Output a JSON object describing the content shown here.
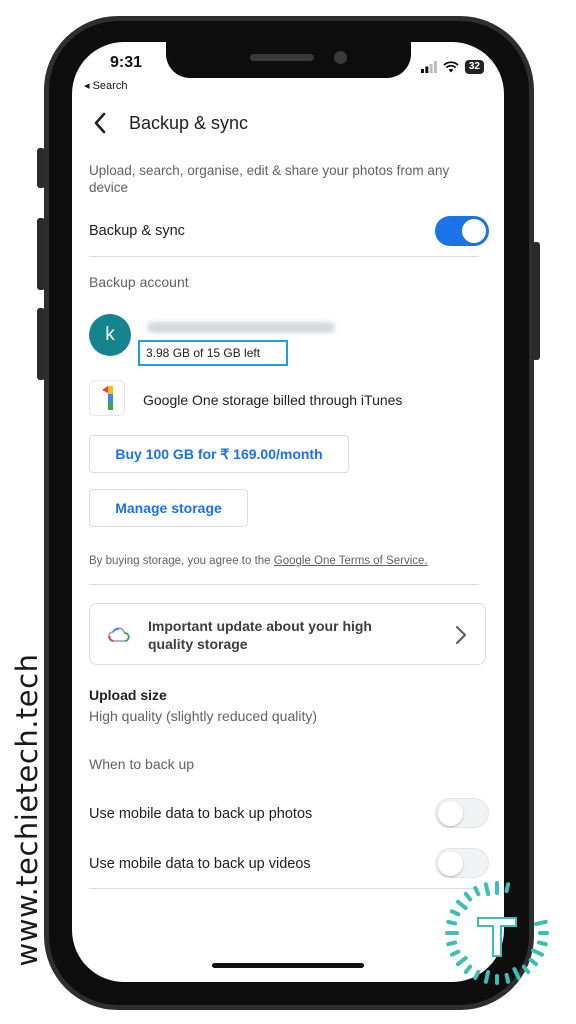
{
  "watermark": {
    "text": "www.techietech.tech"
  },
  "status_bar": {
    "time": "9:31",
    "back_app": "◂ Search",
    "battery": "32"
  },
  "header": {
    "title": "Backup & sync"
  },
  "description": "Upload, search, organise, edit & share your photos from any device",
  "backup_sync": {
    "label": "Backup & sync",
    "enabled": true
  },
  "backup_account": {
    "heading": "Backup account",
    "avatar_letter": "k",
    "storage_left": "3.98 GB of 15 GB left"
  },
  "google_one": {
    "text": "Google One storage billed through iTunes"
  },
  "buttons": {
    "buy": "Buy 100 GB for ₹ 169.00/month",
    "manage": "Manage storage"
  },
  "agreement": {
    "prefix": "By buying storage, you agree to the ",
    "link": "Google One Terms of Service."
  },
  "update_card": {
    "text": "Important update about your high quality storage"
  },
  "upload_size": {
    "label": "Upload size",
    "value": "High quality (slightly reduced quality)"
  },
  "when_to_back_up": {
    "heading": "When to back up",
    "photos_label": "Use mobile data to back up photos",
    "photos_enabled": false,
    "videos_label": "Use mobile data to back up videos",
    "videos_enabled": false
  },
  "colors": {
    "accent": "#1a73e8",
    "avatar": "#14858e",
    "highlight_box": "#1ba3dd",
    "logo": "#3dbfb3"
  },
  "icons": [
    "back-arrow-icon",
    "google-one-icon",
    "cloud-icon",
    "chevron-right-icon",
    "signal-icon",
    "wifi-icon",
    "battery-icon",
    "techietech-logo-icon"
  ]
}
